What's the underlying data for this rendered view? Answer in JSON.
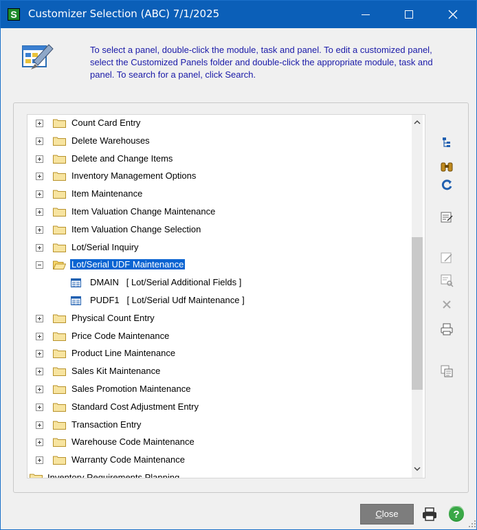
{
  "window": {
    "title": "Customizer Selection (ABC) 7/1/2025",
    "app_icon_letter": "S"
  },
  "header": {
    "instructions": "To select a panel, double-click the module, task and panel. To edit a customized panel, select the Customized Panels folder and double-click the appropriate module, task and panel. To search for a panel, click Search."
  },
  "tree": {
    "items": [
      {
        "label": "Count Card Entry",
        "type": "folder",
        "expanded": false
      },
      {
        "label": "Delete Warehouses",
        "type": "folder",
        "expanded": false
      },
      {
        "label": "Delete and Change Items",
        "type": "folder",
        "expanded": false
      },
      {
        "label": "Inventory Management Options",
        "type": "folder",
        "expanded": false
      },
      {
        "label": "Item Maintenance",
        "type": "folder",
        "expanded": false
      },
      {
        "label": "Item Valuation Change Maintenance",
        "type": "folder",
        "expanded": false
      },
      {
        "label": "Item Valuation Change Selection",
        "type": "folder",
        "expanded": false
      },
      {
        "label": "Lot/Serial Inquiry",
        "type": "folder",
        "expanded": false
      },
      {
        "label": "Lot/Serial UDF Maintenance",
        "type": "folder",
        "expanded": true,
        "selected": true
      },
      {
        "label": "DMAIN   [ Lot/Serial Additional Fields ]",
        "type": "panel"
      },
      {
        "label": "PUDF1   [ Lot/Serial Udf Maintenance ]",
        "type": "panel"
      },
      {
        "label": "Physical Count Entry",
        "type": "folder",
        "expanded": false
      },
      {
        "label": "Price Code Maintenance",
        "type": "folder",
        "expanded": false
      },
      {
        "label": "Product Line Maintenance",
        "type": "folder",
        "expanded": false
      },
      {
        "label": "Sales Kit Maintenance",
        "type": "folder",
        "expanded": false
      },
      {
        "label": "Sales Promotion Maintenance",
        "type": "folder",
        "expanded": false
      },
      {
        "label": "Standard Cost Adjustment Entry",
        "type": "folder",
        "expanded": false
      },
      {
        "label": "Transaction Entry",
        "type": "folder",
        "expanded": false
      },
      {
        "label": "Warehouse Code Maintenance",
        "type": "folder",
        "expanded": false
      },
      {
        "label": "Warranty Code Maintenance",
        "type": "folder",
        "expanded": false
      },
      {
        "label": "Inventory Requirements Planning",
        "type": "module",
        "partial": true
      }
    ]
  },
  "toolbar_icons": [
    "tree-view-icon",
    "binoculars-search-icon",
    "refresh-icon",
    "edit-panel-icon",
    "customize-panel-icon",
    "preview-panel-icon",
    "delete-icon",
    "print-icon",
    "copy-panel-icon"
  ],
  "footer": {
    "close_label": "Close",
    "close_mnemonic": "C",
    "close_rest": "lose"
  },
  "colors": {
    "titlebar": "#0b5fb8",
    "selection": "#0a64d2",
    "instructions_text": "#1a1aa8",
    "folder": "#f7d66a",
    "close_button": "#7d7d7d"
  }
}
